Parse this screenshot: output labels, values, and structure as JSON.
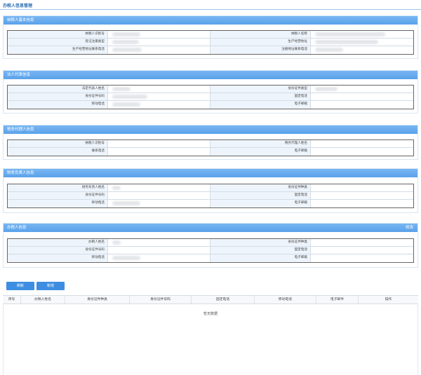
{
  "page_title": "办税人信息管理",
  "sections": {
    "taxpayer": {
      "title": "纳税人基本信息",
      "rows": [
        [
          "纳税人识别号",
          "纳税人名称"
        ],
        [
          "登记注册类型",
          "生产经营地址"
        ],
        [
          "生产经营地址联系电话",
          "注册地址联系电话"
        ]
      ]
    },
    "legal": {
      "title": "法人代表信息",
      "rows": [
        [
          "法定代表人姓名",
          "身份证件类型"
        ],
        [
          "身份证件号码",
          "固定电话"
        ],
        [
          "移动电话",
          "电子邮箱"
        ]
      ]
    },
    "agent": {
      "title": "税务代理人信息",
      "rows": [
        [
          "纳税人识别号",
          "税务代理人姓名"
        ],
        [
          "联系电话",
          "电子邮箱"
        ]
      ]
    },
    "finance": {
      "title": "财务负责人信息",
      "rows": [
        [
          "财务负责人姓名",
          "身份证件种类"
        ],
        [
          "身份证件号码",
          "固定电话"
        ],
        [
          "移动电话",
          "电子邮箱"
        ]
      ]
    },
    "handler": {
      "title": "办税人信息",
      "edit_label": "修改",
      "rows": [
        [
          "办税人姓名",
          "身份证件种类"
        ],
        [
          "身份证件号码",
          "固定电话"
        ],
        [
          "移动电话",
          "电子邮箱"
        ]
      ]
    }
  },
  "toolbar": {
    "refresh_label": "刷新",
    "add_label": "新增"
  },
  "table": {
    "columns": [
      "序号",
      "办税人姓名",
      "身份证件种类",
      "身份证件号码",
      "固定电话",
      "移动电话",
      "电子邮件",
      "操作"
    ],
    "empty_text": "暂无数据"
  },
  "colors": {
    "accent": "#5aa2ea",
    "button": "#3d8ee2",
    "label_bg": "#eef4fb"
  }
}
